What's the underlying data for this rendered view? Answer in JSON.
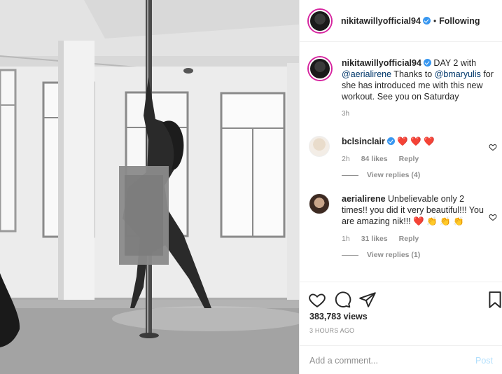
{
  "post": {
    "username": "nikitawillyofficial94",
    "follow_state": "Following",
    "caption": {
      "username": "nikitawillyofficial94",
      "text_1": " DAY 2 with ",
      "mention_1": "@aerialirene",
      "text_2": " Thanks to ",
      "mention_2": "@bmaryulis",
      "text_3": " for she has introduced me with this new workout. See you on Saturday",
      "time": "3h"
    },
    "comments": [
      {
        "username": "bclsinclair",
        "text": "❤️ ❤️ ❤️",
        "time": "2h",
        "likes": "84 likes",
        "reply": "Reply",
        "view_replies": "View replies (4)"
      },
      {
        "username": "aerialirene",
        "text": " Unbelievable only 2 times!! you did it very beautiful!!! You are amazing nik!!! ❤️ 👏 👏 👏",
        "time": "1h",
        "likes": "31 likes",
        "reply": "Reply",
        "view_replies": "View replies (1)"
      }
    ],
    "views": "383,783 views",
    "posted": "3 HOURS AGO",
    "add_comment_placeholder": "Add a comment...",
    "post_button": "Post"
  },
  "colors": {
    "verified": "#3897f0",
    "heart": "#ed4956",
    "muted": "#8e8e8e",
    "post_disabled": "#b2dffc"
  },
  "icons": [
    "heart-icon",
    "comment-icon",
    "share-icon",
    "bookmark-icon",
    "verified-icon",
    "small-heart-icon"
  ]
}
